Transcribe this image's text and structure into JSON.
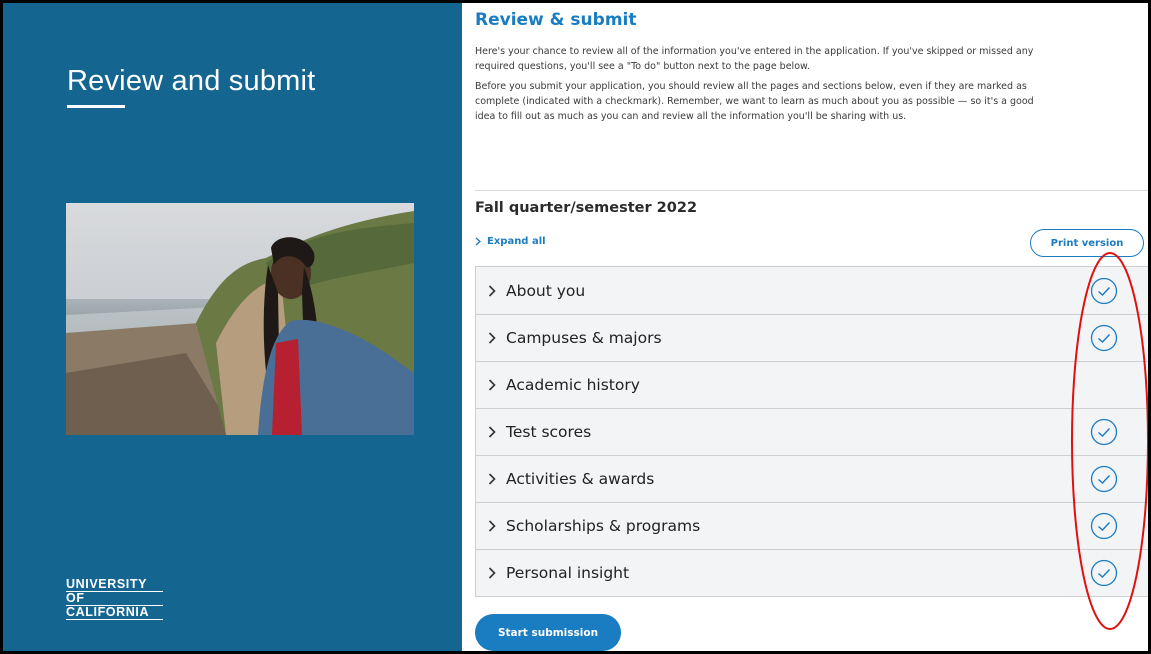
{
  "left_panel": {
    "title": "Review and submit",
    "logo": [
      "UNIVERSITY",
      "OF",
      "CALIFORNIA"
    ]
  },
  "review": {
    "heading": "Review & submit",
    "intro": [
      "Here's your chance to review all of the information you've entered in the application. If you've skipped or missed any required questions, you'll see a \"To do\" button next to the page below.",
      "Before you submit your application, you should review all the pages and sections below, even if they are marked as complete (indicated with a checkmark). Remember, we want to learn as much about you as possible — so it's a good idea to fill out as much as you can and review all the information you'll be sharing with us."
    ],
    "term": "Fall quarter/semester 2022",
    "expand_all": "Expand all",
    "print_version": "Print version",
    "sections": [
      {
        "label": "About you",
        "complete": true
      },
      {
        "label": "Campuses & majors",
        "complete": true
      },
      {
        "label": "Academic history",
        "complete": false
      },
      {
        "label": "Test scores",
        "complete": true
      },
      {
        "label": "Activities & awards",
        "complete": true
      },
      {
        "label": "Scholarships & programs",
        "complete": true
      },
      {
        "label": "Personal insight",
        "complete": true
      }
    ],
    "start_submission": "Start submission"
  },
  "colors": {
    "panel_blue": "#156591",
    "accent_blue": "#1a7cc1",
    "annotation_red": "#e01010"
  }
}
